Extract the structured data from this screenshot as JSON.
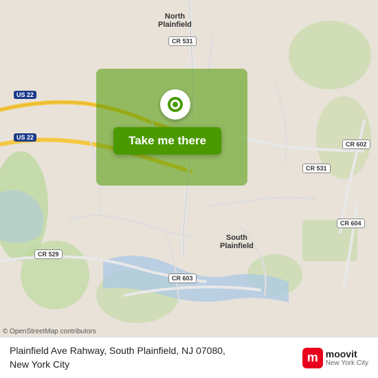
{
  "map": {
    "alt": "Map showing Plainfield Ave Rahway, South Plainfield, NJ 07080",
    "labels": {
      "north_plainfield": "North\nPlainfield",
      "south_plainfield": "South\nPlainfield"
    },
    "shields": {
      "us22_1": "US 22",
      "us22_2": "US 22",
      "cr531_1": "CR 531",
      "cr531_2": "CR 531",
      "cr529": "CR 529",
      "cr602": "CR 602",
      "cr604": "CR 604",
      "cr603": "CR 603"
    },
    "attribution": "© OpenStreetMap contributors"
  },
  "button": {
    "label": "Take me there"
  },
  "bottom_bar": {
    "address_line1": "Plainfield Ave Rahway, South Plainfield, NJ 07080,",
    "address_line2": "New York City"
  },
  "moovit": {
    "logo_letter": "m",
    "app_name": "moovit",
    "subtitle": "New York City"
  }
}
